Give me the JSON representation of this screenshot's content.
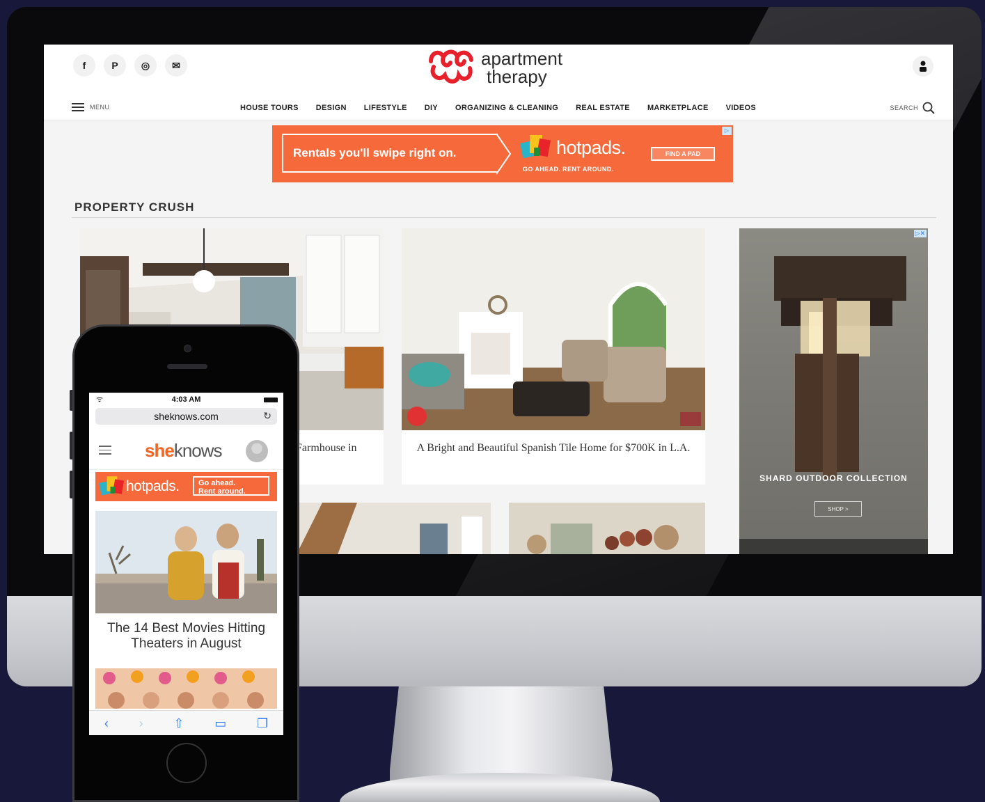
{
  "desktop": {
    "social_icons": [
      "facebook-icon",
      "pinterest-icon",
      "instagram-icon",
      "email-icon"
    ],
    "social_glyphs": [
      "f",
      "P",
      "◎",
      "✉"
    ],
    "logo": {
      "line1": "apartment",
      "line2": "therapy",
      "color": "#e8202c"
    },
    "menu_label": "MENU",
    "nav_items": [
      "HOUSE TOURS",
      "DESIGN",
      "LIFESTYLE",
      "DIY",
      "ORGANIZING & CLEANING",
      "REAL ESTATE",
      "MARKETPLACE",
      "VIDEOS"
    ],
    "search_label": "SEARCH",
    "ad": {
      "text": "Rentals you'll swipe right on.",
      "brand": "hotpads.",
      "tagline": "GO AHEAD. RENT AROUND.",
      "cta": "FIND A PAD",
      "color": "#f5693b"
    },
    "section_title": "PROPERTY CRUSH",
    "cards": [
      {
        "title": "Farmhouse in"
      },
      {
        "title": "A Bright and Beautiful Spanish Tile Home for $700K in L.A."
      }
    ],
    "side_ad": {
      "title": "SHARD OUTDOOR COLLECTION",
      "cta": "SHOP >"
    }
  },
  "phone": {
    "time": "4:03 AM",
    "url": "sheknows.com",
    "logo_she": "she",
    "logo_knows": "knows",
    "ad": {
      "brand": "hotpads.",
      "line1": "Go ahead.",
      "line2": "Rent around."
    },
    "headline": "The 14 Best Movies Hitting Theaters in August",
    "toolbar_icons": [
      "back-icon",
      "forward-icon",
      "share-icon",
      "bookmarks-icon",
      "tabs-icon"
    ],
    "toolbar_glyphs": [
      "‹",
      "›",
      "⇧",
      "▭",
      "❐"
    ]
  }
}
